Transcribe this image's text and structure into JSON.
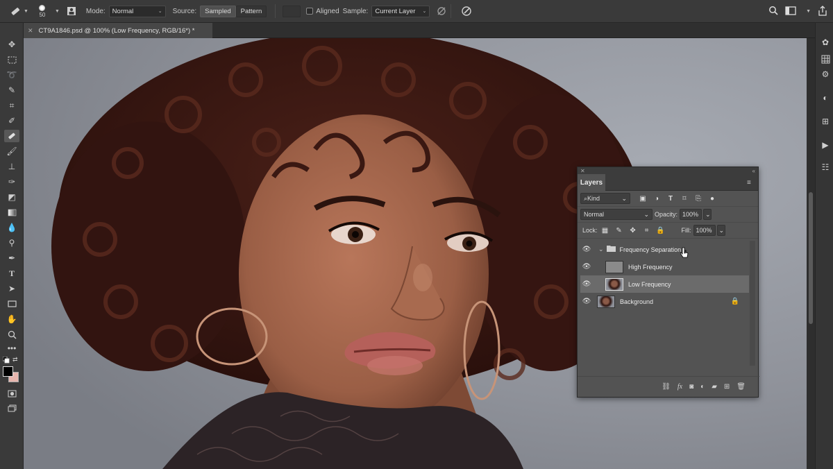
{
  "options_bar": {
    "brush_size": "50",
    "mode_label": "Mode:",
    "mode_value": "Normal",
    "source_label": "Source:",
    "sampled_label": "Sampled",
    "pattern_label": "Pattern",
    "aligned_label": "Aligned",
    "sample_label": "Sample:",
    "sample_value": "Current Layer"
  },
  "document": {
    "tab_title": "CT9A1846.psd @ 100% (Low Frequency, RGB/16*) *"
  },
  "layers_panel": {
    "tab_label": "Layers",
    "kind_label": "Kind",
    "blend_mode": "Normal",
    "opacity_label": "Opacity:",
    "opacity_value": "100%",
    "lock_label": "Lock:",
    "fill_label": "Fill:",
    "fill_value": "100%",
    "layers": [
      {
        "name": "Frequency Separation",
        "type": "group"
      },
      {
        "name": "High Frequency",
        "type": "layer"
      },
      {
        "name": "Low Frequency",
        "type": "layer",
        "selected": true
      },
      {
        "name": "Background",
        "type": "background",
        "locked": true
      }
    ]
  },
  "colors": {
    "app_bg": "#3a3a3a",
    "panel_bg": "#535353",
    "selected_layer": "#6b6b6b",
    "foreground_color": "#000000",
    "background_color": "#e6b5ad"
  }
}
